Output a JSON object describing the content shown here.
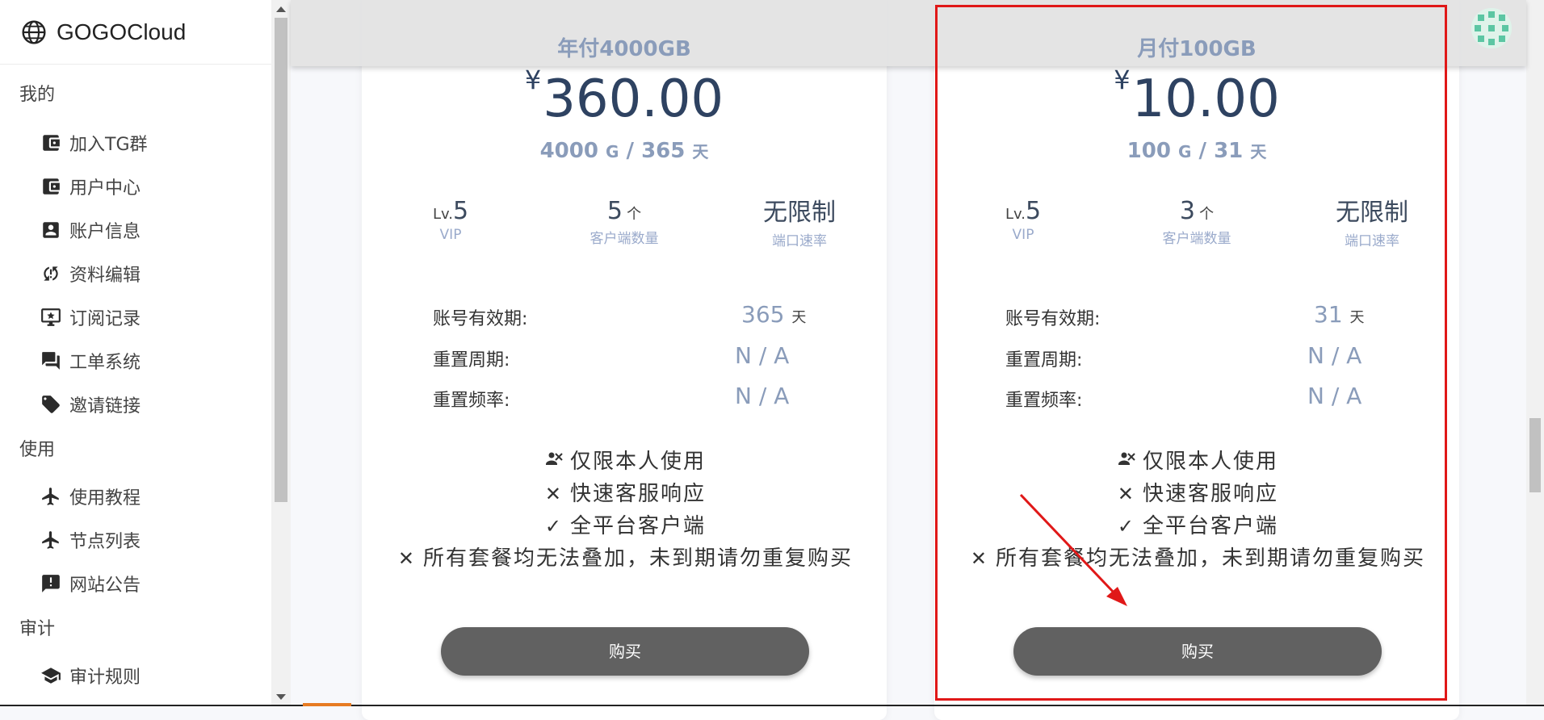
{
  "brand": {
    "name": "GOGOCloud"
  },
  "sidebar": {
    "sections": [
      {
        "title": "我的",
        "items": [
          {
            "label": "加入TG群",
            "icon": "wallet-icon"
          },
          {
            "label": "用户中心",
            "icon": "wallet-icon"
          },
          {
            "label": "账户信息",
            "icon": "account-box-icon"
          },
          {
            "label": "资料编辑",
            "icon": "sync-alert-icon"
          },
          {
            "label": "订阅记录",
            "icon": "monitor-star-icon"
          },
          {
            "label": "工单系统",
            "icon": "forum-icon"
          },
          {
            "label": "邀请链接",
            "icon": "tag-icon"
          }
        ]
      },
      {
        "title": "使用",
        "items": [
          {
            "label": "使用教程",
            "icon": "airplane-icon"
          },
          {
            "label": "节点列表",
            "icon": "airplane-icon"
          },
          {
            "label": "网站公告",
            "icon": "announcement-icon"
          }
        ]
      },
      {
        "title": "审计",
        "items": [
          {
            "label": "审计规则",
            "icon": "school-icon"
          }
        ]
      }
    ]
  },
  "plans": [
    {
      "title": "年付4000GB",
      "currency": "¥",
      "price": "360.00",
      "quota_amount": "4000",
      "quota_unit": "G",
      "days": "365",
      "days_unit": "天",
      "vip_prefix": "Lv.",
      "vip_level": "5",
      "vip_label": "VIP",
      "clients": "5",
      "clients_unit": "个",
      "clients_label": "客户端数量",
      "speed": "无限制",
      "speed_label": "端口速率",
      "validity_label": "账号有效期:",
      "validity_value": "365",
      "validity_unit": "天",
      "reset_cycle_label": "重置周期:",
      "reset_cycle_value": "N / A",
      "reset_freq_label": "重置频率:",
      "reset_freq_value": "N / A",
      "features": [
        {
          "icon": "no-share-icon",
          "text": "仅限本人使用"
        },
        {
          "icon": "cross-icon",
          "text": "快速客服响应"
        },
        {
          "icon": "check-icon",
          "text": "全平台客户端"
        },
        {
          "icon": "cross-icon",
          "text": "所有套餐均无法叠加，未到期请勿重复购买"
        }
      ],
      "buy_label": "购买"
    },
    {
      "title": "月付100GB",
      "currency": "¥",
      "price": "10.00",
      "quota_amount": "100",
      "quota_unit": "G",
      "days": "31",
      "days_unit": "天",
      "vip_prefix": "Lv.",
      "vip_level": "5",
      "vip_label": "VIP",
      "clients": "3",
      "clients_unit": "个",
      "clients_label": "客户端数量",
      "speed": "无限制",
      "speed_label": "端口速率",
      "validity_label": "账号有效期:",
      "validity_value": "31",
      "validity_unit": "天",
      "reset_cycle_label": "重置周期:",
      "reset_cycle_value": "N / A",
      "reset_freq_label": "重置频率:",
      "reset_freq_value": "N / A",
      "features": [
        {
          "icon": "no-share-icon",
          "text": "仅限本人使用"
        },
        {
          "icon": "cross-icon",
          "text": "快速客服响应"
        },
        {
          "icon": "check-icon",
          "text": "全平台客户端"
        },
        {
          "icon": "cross-icon",
          "text": "所有套餐均无法叠加，未到期请勿重复购买"
        }
      ],
      "buy_label": "购买"
    }
  ],
  "colors": {
    "accent": "#8a9cba",
    "price": "#2e4261",
    "button": "#616161",
    "highlight": "#e01818"
  }
}
